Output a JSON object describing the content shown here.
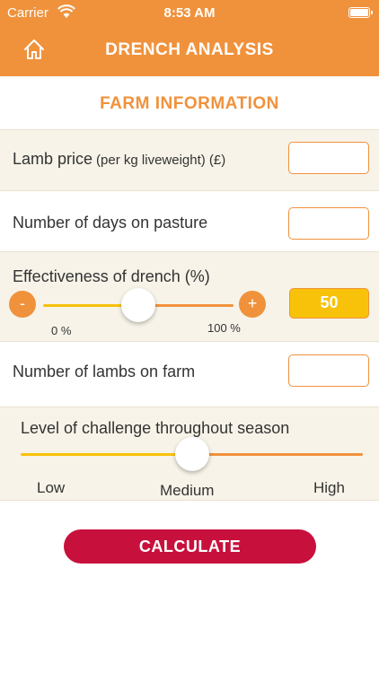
{
  "status_bar": {
    "carrier": "Carrier",
    "time": "8:53 AM"
  },
  "header": {
    "title": "DRENCH ANALYSIS",
    "home_icon": "home-icon"
  },
  "section": {
    "title": "FARM INFORMATION"
  },
  "fields": {
    "lamb_price": {
      "label": "Lamb price",
      "sublabel": "(per kg liveweight) (£)",
      "value": ""
    },
    "days_on_pasture": {
      "label": "Number of days on pasture",
      "value": ""
    },
    "lambs_on_farm": {
      "label": "Number of lambs on farm",
      "value": ""
    }
  },
  "effectiveness": {
    "label": "Effectiveness of drench (%)",
    "minus": "-",
    "plus": "+",
    "min_label": "0 %",
    "max_label": "100 %",
    "value": "50",
    "fraction": 0.5
  },
  "challenge": {
    "label": "Level of challenge throughout season",
    "levels": [
      "Low",
      "Medium",
      "High"
    ],
    "selected": "Medium"
  },
  "calculate": {
    "label": "CALCULATE"
  },
  "colors": {
    "orange": "#f0923c",
    "yellow": "#f8c20b",
    "cream": "#f7f3e8",
    "crimson": "#c8103c"
  }
}
